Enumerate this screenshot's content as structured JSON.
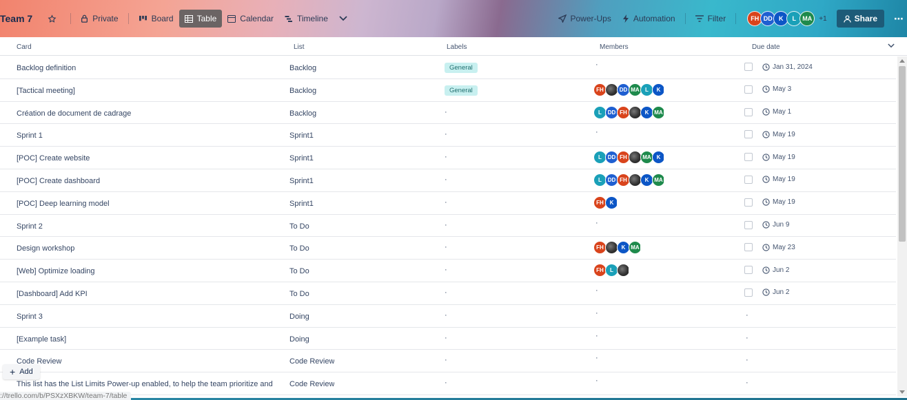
{
  "header": {
    "board_title": "Team 7",
    "visibility_label": "Private",
    "views": [
      "Board",
      "Table",
      "Calendar",
      "Timeline"
    ],
    "active_view": "Table",
    "power_ups_label": "Power-Ups",
    "automation_label": "Automation",
    "filter_label": "Filter",
    "members": [
      {
        "initials": "FH",
        "color": "#d9441c"
      },
      {
        "initials": "DD",
        "color": "#1f5fd1"
      },
      {
        "initials": "K",
        "color": "#0c56c6"
      },
      {
        "initials": "L",
        "color": "#1aa0b8"
      },
      {
        "initials": "MA",
        "color": "#1e8a4c"
      }
    ],
    "extra_members": "+1",
    "share_label": "Share"
  },
  "table": {
    "columns": {
      "card": "Card",
      "list": "List",
      "labels": "Labels",
      "members": "Members",
      "due_date": "Due date"
    },
    "rows": [
      {
        "card": "Backlog definition",
        "list": "Backlog",
        "label": "General",
        "members": [],
        "due": "Jan 31, 2024"
      },
      {
        "card": "[Tactical meeting]",
        "list": "Backlog",
        "label": "General",
        "members": [
          "FH",
          "IMG",
          "DD",
          "MA",
          "L",
          "K"
        ],
        "due": "May 3"
      },
      {
        "card": "Création de document de cadrage",
        "list": "Backlog",
        "label": "",
        "members": [
          "L",
          "DD",
          "FH",
          "IMG",
          "K",
          "MA"
        ],
        "due": "May 1"
      },
      {
        "card": "Sprint 1",
        "list": "Sprint1",
        "label": "",
        "members": [],
        "due": "May 19"
      },
      {
        "card": "[POC] Create website",
        "list": "Sprint1",
        "label": "",
        "members": [
          "L",
          "DD",
          "FH",
          "IMG",
          "MA",
          "K"
        ],
        "due": "May 19"
      },
      {
        "card": "[POC] Create dashboard",
        "list": "Sprint1",
        "label": "",
        "members": [
          "L",
          "DD",
          "FH",
          "IMG",
          "K",
          "MA"
        ],
        "due": "May 19"
      },
      {
        "card": "[POC] Deep learning model",
        "list": "Sprint1",
        "label": "",
        "members": [
          "FH",
          "K"
        ],
        "due": "May 19"
      },
      {
        "card": "Sprint 2",
        "list": "To Do",
        "label": "",
        "members": [],
        "due": "Jun 9"
      },
      {
        "card": "Design workshop",
        "list": "To Do",
        "label": "",
        "members": [
          "FH",
          "IMG",
          "K",
          "MA"
        ],
        "due": "May 23"
      },
      {
        "card": "[Web] Optimize loading",
        "list": "To Do",
        "label": "",
        "members": [
          "FH",
          "L",
          "IMG"
        ],
        "due": "Jun 2"
      },
      {
        "card": "[Dashboard] Add KPI",
        "list": "To Do",
        "label": "",
        "members": [],
        "due": "Jun 2"
      },
      {
        "card": "Sprint 3",
        "list": "Doing",
        "label": "",
        "members": [],
        "due": ""
      },
      {
        "card": "[Example task]",
        "list": "Doing",
        "label": "",
        "members": [],
        "due": ""
      },
      {
        "card": "Code Review",
        "list": "Code Review",
        "label": "",
        "members": [],
        "due": ""
      },
      {
        "card": "This list has the List Limits Power-up enabled, to help the team prioritize and",
        "list": "Code Review",
        "label": "",
        "members": [],
        "due": ""
      }
    ]
  },
  "member_colors": {
    "FH": "#d9441c",
    "DD": "#1f5fd1",
    "K": "#0c56c6",
    "L": "#1aa0b8",
    "MA": "#1e8a4c",
    "IMG": "#3b3b3b"
  },
  "add_label": "Add",
  "status_url": "://trello.com/b/PSXzXBKW/team-7/table"
}
